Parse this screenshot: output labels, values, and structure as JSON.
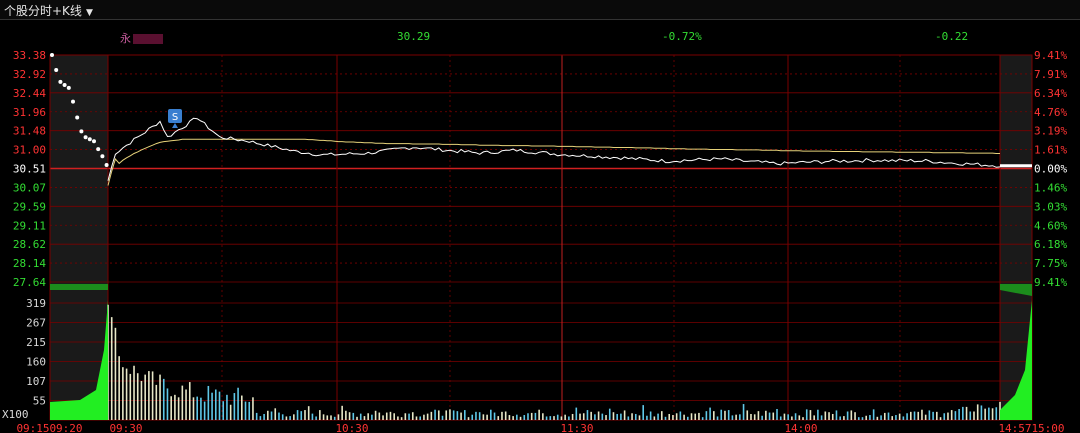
{
  "window": {
    "tab_title": "个股分时+K线"
  },
  "quote": {
    "name": "永",
    "price": "30.29",
    "change_pct": "-0.72%",
    "change": "-0.22"
  },
  "badge": "S",
  "colors": {
    "up": "#ff3333",
    "down": "#33dd33",
    "grid": "#7a0000",
    "price_line": "#ffffff",
    "avg_line": "#e6d27a"
  },
  "chart_data": [
    {
      "type": "line",
      "title": "",
      "series": [
        {
          "name": "",
          "values": []
        },
        {
          "name": "",
          "values": []
        }
      ],
      "prev_close": 30.51,
      "ylim": [
        27.64,
        33.38
      ],
      "y_ticks_left": [
        "33.38",
        "32.92",
        "32.44",
        "31.96",
        "31.48",
        "31.00",
        "30.51",
        "30.07",
        "29.59",
        "29.11",
        "28.62",
        "28.14",
        "27.64"
      ],
      "y_ticks_right": [
        "9.41%",
        "7.91%",
        "6.34%",
        "4.76%",
        "3.19%",
        "1.61%",
        "0.00%",
        "1.46%",
        "3.03%",
        "4.60%",
        "6.18%",
        "7.75%",
        "9.41%"
      ],
      "x_ticks": [
        "09:15",
        "09:20",
        "09:30",
        "10:30",
        "11:30",
        "14:00",
        "14:57",
        "15:00"
      ]
    },
    {
      "type": "bar",
      "title": "",
      "y_ticks": [
        "319",
        "267",
        "215",
        "160",
        "107",
        "55"
      ],
      "unit_label": "X100",
      "series": [
        {
          "name": "",
          "values": []
        }
      ]
    }
  ]
}
